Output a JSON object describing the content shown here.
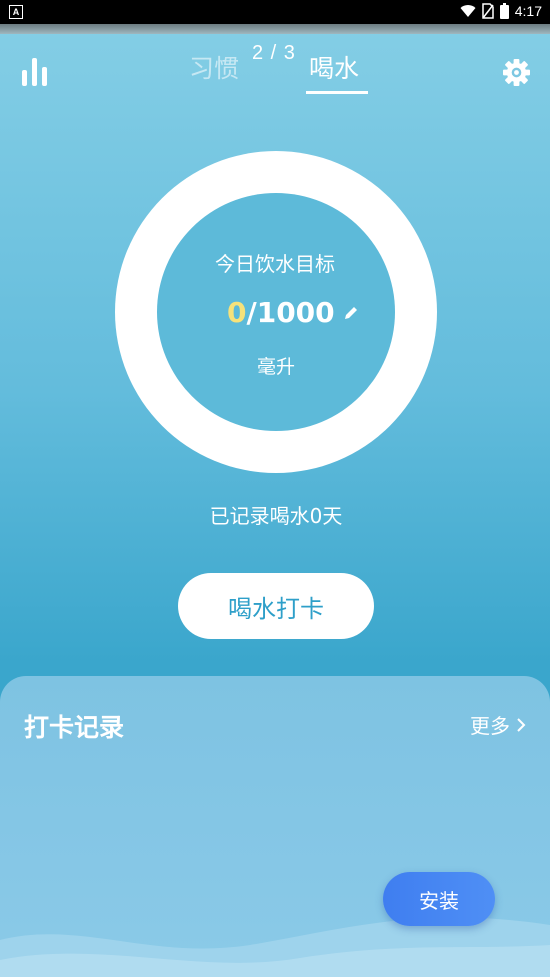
{
  "status_bar": {
    "notification_icon_label": "A",
    "time": "4:17",
    "icons": [
      "wifi-icon",
      "no-sim-icon",
      "battery-icon"
    ]
  },
  "page_indicator": "2 / 3",
  "tabs": [
    {
      "label": "习惯",
      "active": false
    },
    {
      "label": "喝水",
      "active": true
    }
  ],
  "goal": {
    "title": "今日饮水目标",
    "current": "0",
    "target": "/1000",
    "unit": "毫升"
  },
  "record_days_text": "已记录喝水0天",
  "checkin_button_label": "喝水打卡",
  "records": {
    "title": "打卡记录",
    "more_label": "更多"
  },
  "install_button_label": "安装",
  "colors": {
    "accent": "#2e9fc9",
    "highlight": "#f7e27a",
    "install": "#4a88f3"
  }
}
